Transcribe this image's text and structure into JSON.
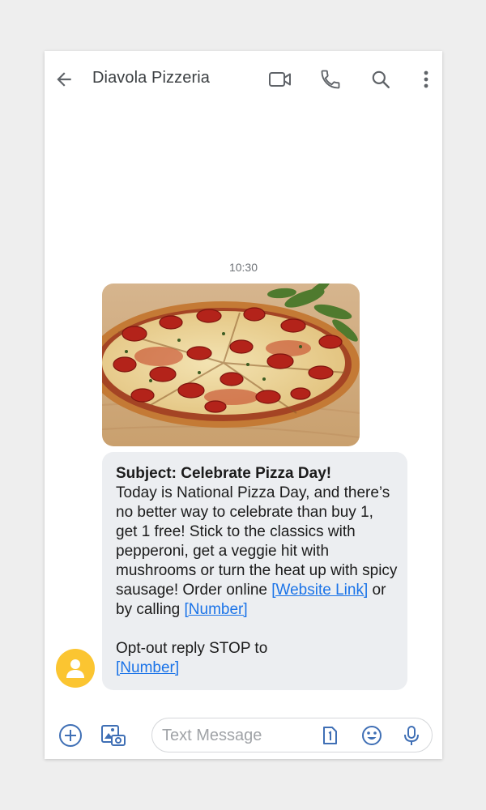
{
  "header": {
    "title": "Diavola Pizzeria",
    "icons": [
      "back-arrow-icon",
      "video-call-icon",
      "phone-icon",
      "search-icon",
      "more-vert-icon"
    ]
  },
  "conversation": {
    "timestamp": "10:30",
    "image": {
      "subject": "pepperoni pizza on wooden board with basil"
    },
    "message": {
      "subject": "Subject: Celebrate Pizza Day!",
      "body_1": "Today is National Pizza Day, and there’s no better way to celebrate than buy 1, get 1 free! Stick to the classics with pepperoni, get a veggie hit with mushrooms or turn the heat up with spicy sausage! Order online",
      "link_website": "[Website Link]",
      "mid_text": " or by calling ",
      "link_number": "[Number]",
      "optout_text": "Opt-out reply STOP to",
      "optout_link": "[Number]"
    },
    "avatar_color": "#fbc531"
  },
  "compose": {
    "placeholder": "Text Message",
    "icons": [
      "add-circle-icon",
      "gallery-icon",
      "sim-1-icon",
      "emoji-icon",
      "mic-icon"
    ]
  },
  "colors": {
    "accent": "#3f6fb5",
    "link": "#1a73e8",
    "bubble": "#eceef1"
  }
}
